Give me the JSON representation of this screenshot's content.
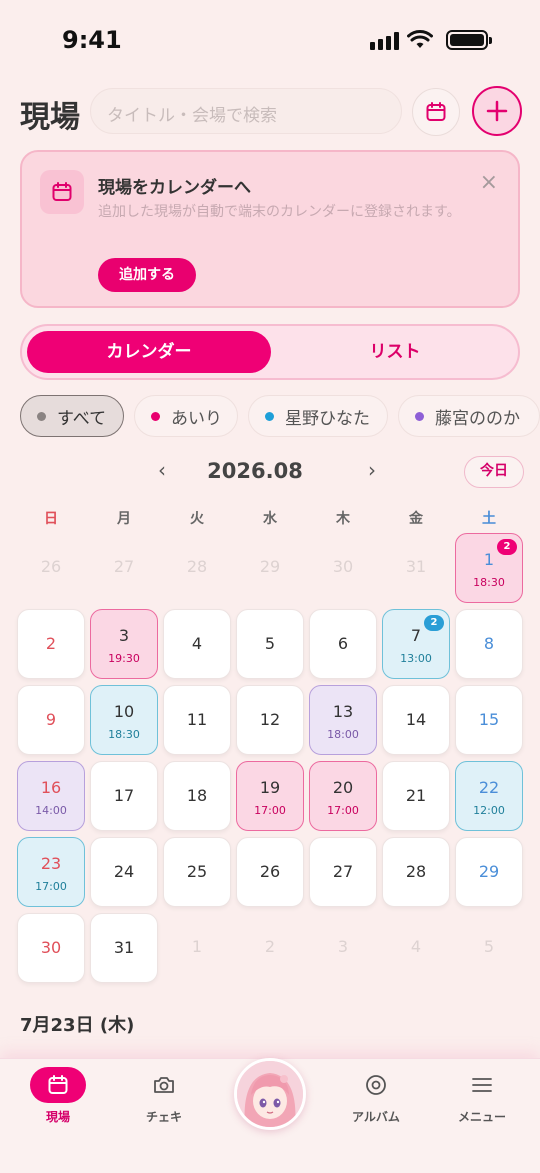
{
  "status_bar": {
    "time": "9:41"
  },
  "header": {
    "title": "現場",
    "search_placeholder": "タイトル・会場で検索"
  },
  "banner": {
    "title": "現場をカレンダーへ",
    "description": "追加した現場が自動で端末のカレンダーに登録されます。",
    "button_label": "追加する",
    "close_label": "×"
  },
  "segments": [
    {
      "label": "カレンダー",
      "active": true
    },
    {
      "label": "リスト",
      "active": false
    }
  ],
  "filters": [
    {
      "label": "すべて",
      "color": "#8a8382",
      "selected": true
    },
    {
      "label": "あいり",
      "color": "#e8006f",
      "selected": false
    },
    {
      "label": "星野ひなた",
      "color": "#1e9fd8",
      "selected": false
    },
    {
      "label": "藤宮ののか",
      "color": "#8e5fd6",
      "selected": false
    }
  ],
  "calendar": {
    "prev_label": "‹",
    "month_label": "2026.08",
    "next_label": "›",
    "today_label": "今日",
    "weekdays": [
      "日",
      "月",
      "火",
      "水",
      "木",
      "金",
      "土"
    ],
    "weeks": [
      [
        {
          "day": "26",
          "muted": true
        },
        {
          "day": "27",
          "muted": true
        },
        {
          "day": "28",
          "muted": true
        },
        {
          "day": "29",
          "muted": true
        },
        {
          "day": "30",
          "muted": true
        },
        {
          "day": "31",
          "muted": true
        },
        {
          "day": "1",
          "event": "pink",
          "time": "18:30",
          "badge": "2"
        }
      ],
      [
        {
          "day": "2"
        },
        {
          "day": "3",
          "event": "pink",
          "time": "19:30"
        },
        {
          "day": "4"
        },
        {
          "day": "5"
        },
        {
          "day": "6"
        },
        {
          "day": "7",
          "event": "blue",
          "time": "13:00",
          "badge": "2"
        },
        {
          "day": "8"
        }
      ],
      [
        {
          "day": "9"
        },
        {
          "day": "10",
          "event": "blue",
          "time": "18:30"
        },
        {
          "day": "11"
        },
        {
          "day": "12"
        },
        {
          "day": "13",
          "event": "purple",
          "time": "18:00"
        },
        {
          "day": "14"
        },
        {
          "day": "15"
        }
      ],
      [
        {
          "day": "16",
          "event": "purple",
          "time": "14:00"
        },
        {
          "day": "17"
        },
        {
          "day": "18"
        },
        {
          "day": "19",
          "event": "pink",
          "time": "17:00"
        },
        {
          "day": "20",
          "event": "pink",
          "time": "17:00"
        },
        {
          "day": "21"
        },
        {
          "day": "22",
          "event": "blue",
          "time": "12:00"
        }
      ],
      [
        {
          "day": "23",
          "event": "blue",
          "time": "17:00"
        },
        {
          "day": "24"
        },
        {
          "day": "25"
        },
        {
          "day": "26"
        },
        {
          "day": "27"
        },
        {
          "day": "28"
        },
        {
          "day": "29"
        }
      ],
      [
        {
          "day": "30"
        },
        {
          "day": "31"
        },
        {
          "day": "1",
          "muted": true
        },
        {
          "day": "2",
          "muted": true
        },
        {
          "day": "3",
          "muted": true
        },
        {
          "day": "4",
          "muted": true
        },
        {
          "day": "5",
          "muted": true
        }
      ]
    ]
  },
  "selected_date_heading": "7月23日 (木)",
  "tab_bar": [
    {
      "label": "現場",
      "icon": "calendar-icon",
      "active": true
    },
    {
      "label": "チェキ",
      "icon": "camera-icon",
      "active": false
    },
    {
      "label": "アルバム",
      "icon": "album-icon",
      "active": false
    },
    {
      "label": "メニュー",
      "icon": "menu-icon",
      "active": false
    }
  ],
  "colors": {
    "accent": "#ef0075",
    "pink_event": "#fbd7e4",
    "blue_event": "#dff1f8",
    "purple_event": "#ece4f6",
    "sunday": "#e0505a",
    "saturday": "#4a8ed8"
  }
}
